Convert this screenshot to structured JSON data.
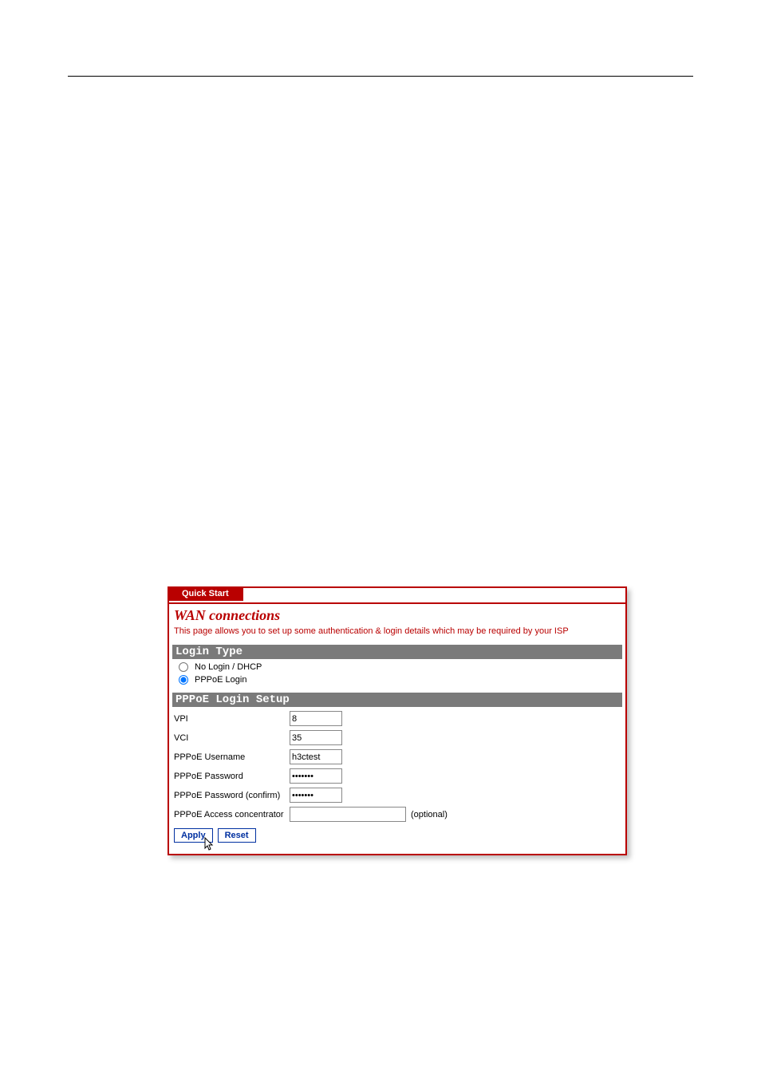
{
  "tab": {
    "label": "Quick Start"
  },
  "header": {
    "title": "WAN connections",
    "desc": "This page allows you to set up some authentication & login details which may be required by your ISP"
  },
  "login_type": {
    "section_label": "Login Type",
    "option_no_login": "No Login / DHCP",
    "option_pppoe": "PPPoE Login"
  },
  "pppoe": {
    "section_label": "PPPoE Login Setup",
    "vpi_label": "VPI",
    "vpi_value": "8",
    "vci_label": "VCI",
    "vci_value": "35",
    "username_label": "PPPoE Username",
    "username_value": "h3ctest",
    "password_label": "PPPoE Password",
    "password_value": "•••••••",
    "password_confirm_label": "PPPoE Password (confirm)",
    "password_confirm_value": "•••••••",
    "ac_label": "PPPoE Access concentrator",
    "ac_value": "",
    "optional_text": "(optional)"
  },
  "buttons": {
    "apply": "Apply",
    "reset": "Reset"
  }
}
